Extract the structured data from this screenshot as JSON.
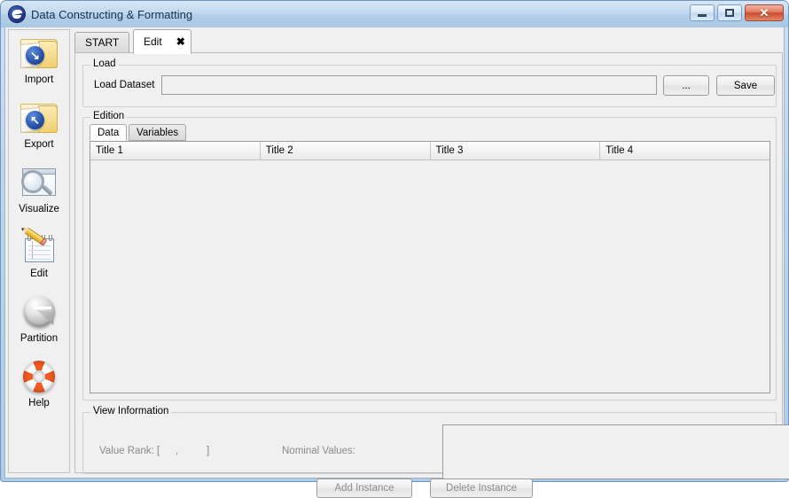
{
  "window": {
    "title": "Data Constructing & Formatting",
    "app_icon": "app-logo-icon",
    "controls": {
      "minimize": "minimize-icon",
      "maximize": "maximize-icon",
      "close": "✕"
    }
  },
  "sidebar": {
    "items": [
      {
        "label": "Import",
        "icon": "folder-import-icon"
      },
      {
        "label": "Export",
        "icon": "folder-export-icon"
      },
      {
        "label": "Visualize",
        "icon": "magnifier-window-icon"
      },
      {
        "label": "Edit",
        "icon": "pencil-notepad-icon"
      },
      {
        "label": "Partition",
        "icon": "pie-chart-icon"
      },
      {
        "label": "Help",
        "icon": "life-ring-icon"
      }
    ]
  },
  "tabs": [
    {
      "label": "START",
      "active": false,
      "closable": false
    },
    {
      "label": "Edit",
      "active": true,
      "closable": true
    }
  ],
  "load": {
    "group_title": "Load",
    "dataset_label": "Load Dataset",
    "dataset_value": "",
    "dataset_placeholder": "",
    "browse_label": "...",
    "save_label": "Save"
  },
  "edition": {
    "group_title": "Edition",
    "inner_tabs": [
      {
        "label": "Data",
        "active": true
      },
      {
        "label": "Variables",
        "active": false
      }
    ],
    "table": {
      "columns": [
        "Title 1",
        "Title 2",
        "Title 3",
        "Title 4"
      ],
      "rows": []
    }
  },
  "view_information": {
    "group_title": "View Information",
    "value_rank_label": "Value Rank: [",
    "value_rank_comma": ",",
    "value_rank_close": "]",
    "value_rank_min": "",
    "value_rank_max": "",
    "nominal_values_label": "Nominal Values:",
    "nominal_values_text": ""
  },
  "actions": {
    "add_instance_label": "Add Instance",
    "delete_instance_label": "Delete Instance"
  },
  "colors": {
    "titlebar_blue": "#bdd4ec",
    "panel_grey": "#f0f0f0",
    "border_grey": "#9b9b9b",
    "close_red": "#cc4a2c",
    "disabled_text": "#8a8a8a",
    "accent_orange": "#f05a22"
  }
}
